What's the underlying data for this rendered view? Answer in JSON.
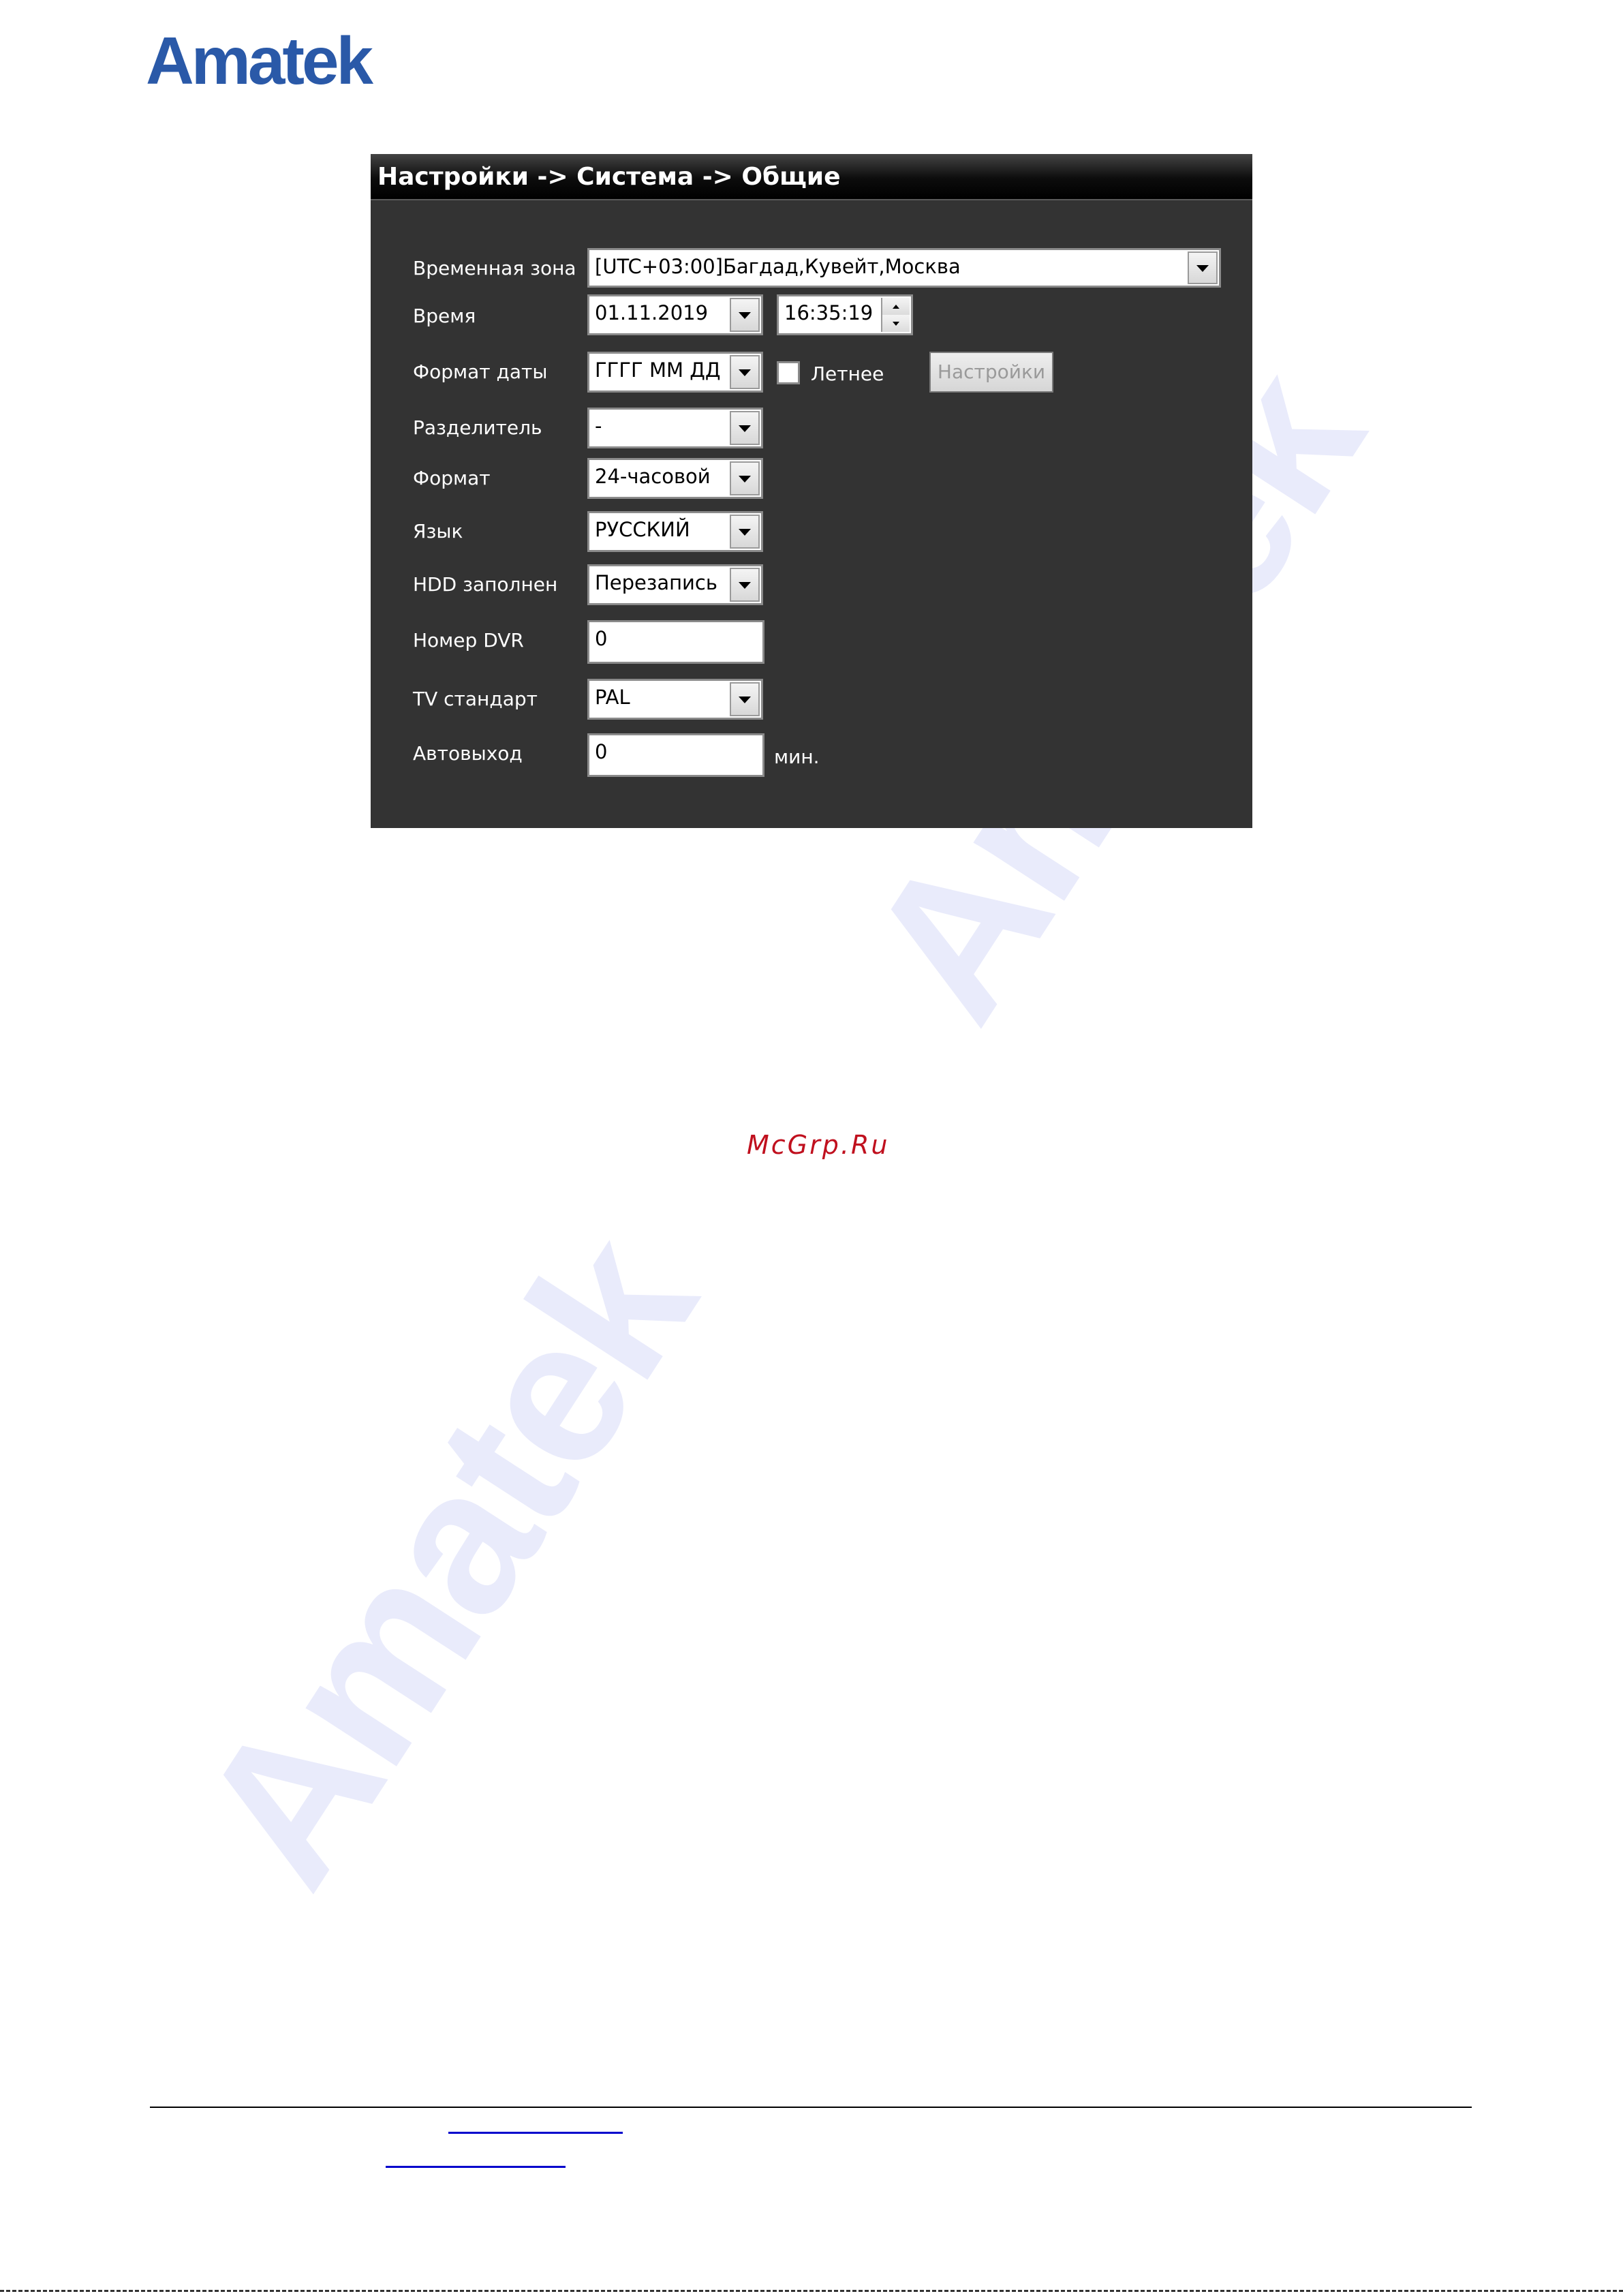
{
  "header": {
    "logo_text": "Amatek"
  },
  "watermark": {
    "text": "Amatek"
  },
  "panel": {
    "title": "Настройки -> Система -> Общие",
    "fields": {
      "timezone": {
        "label": "Временная зона",
        "value": "[UTC+03:00]Багдад,Кувейт,Москва"
      },
      "time": {
        "label": "Время",
        "date": "01.11.2019",
        "clock": "16:35:19"
      },
      "date_format": {
        "label": "Формат даты",
        "value": "ГГГГ ММ ДД",
        "dst_label": "Летнее",
        "dst_checked": false,
        "settings_button": "Настройки"
      },
      "separator": {
        "label": "Разделитель",
        "value": "-"
      },
      "time_format": {
        "label": "Формат",
        "value": "24-часовой"
      },
      "language": {
        "label": "Язык",
        "value": "РУССКИЙ"
      },
      "hdd_full": {
        "label": "HDD заполнен",
        "value": "Перезапись"
      },
      "dvr_number": {
        "label": "Номер DVR",
        "value": "0"
      },
      "tv_standard": {
        "label": "TV стандарт",
        "value": "PAL"
      },
      "auto_logout": {
        "label": "Автовыход",
        "value": "0",
        "unit": "мин."
      }
    }
  },
  "footer_mark": "McGrp.Ru"
}
